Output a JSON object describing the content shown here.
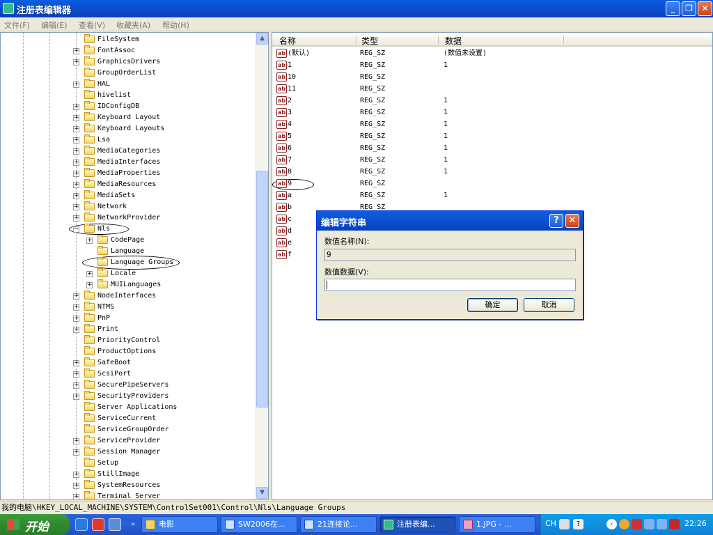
{
  "window": {
    "title": "注册表编辑器"
  },
  "menu": [
    "文件(F)",
    "编辑(E)",
    "查看(V)",
    "收藏夹(A)",
    "帮助(H)"
  ],
  "tree": [
    {
      "label": "FileSystem",
      "expandable": false,
      "level": 1
    },
    {
      "label": "FontAssoc",
      "expandable": true,
      "level": 1
    },
    {
      "label": "GraphicsDrivers",
      "expandable": true,
      "level": 1
    },
    {
      "label": "GroupOrderList",
      "expandable": false,
      "level": 1
    },
    {
      "label": "HAL",
      "expandable": true,
      "level": 1
    },
    {
      "label": "hivelist",
      "expandable": false,
      "level": 1
    },
    {
      "label": "IDConfigDB",
      "expandable": true,
      "level": 1
    },
    {
      "label": "Keyboard Layout",
      "expandable": true,
      "level": 1
    },
    {
      "label": "Keyboard Layouts",
      "expandable": true,
      "level": 1
    },
    {
      "label": "Lsa",
      "expandable": true,
      "level": 1
    },
    {
      "label": "MediaCategories",
      "expandable": true,
      "level": 1
    },
    {
      "label": "MediaInterfaces",
      "expandable": true,
      "level": 1
    },
    {
      "label": "MediaProperties",
      "expandable": true,
      "level": 1
    },
    {
      "label": "MediaResources",
      "expandable": true,
      "level": 1
    },
    {
      "label": "MediaSets",
      "expandable": true,
      "level": 1
    },
    {
      "label": "Network",
      "expandable": true,
      "level": 1
    },
    {
      "label": "NetworkProvider",
      "expandable": true,
      "level": 1
    },
    {
      "label": "Nls",
      "expandable": true,
      "expanded": true,
      "level": 1
    },
    {
      "label": "CodePage",
      "expandable": true,
      "level": 2
    },
    {
      "label": "Language",
      "expandable": false,
      "level": 2
    },
    {
      "label": "Language Groups",
      "expandable": false,
      "level": 2,
      "selected": true
    },
    {
      "label": "Locale",
      "expandable": true,
      "level": 2
    },
    {
      "label": "MUILanguages",
      "expandable": true,
      "level": 2
    },
    {
      "label": "NodeInterfaces",
      "expandable": true,
      "level": 1
    },
    {
      "label": "NTMS",
      "expandable": true,
      "level": 1
    },
    {
      "label": "PnP",
      "expandable": true,
      "level": 1
    },
    {
      "label": "Print",
      "expandable": true,
      "level": 1
    },
    {
      "label": "PriorityControl",
      "expandable": false,
      "level": 1
    },
    {
      "label": "ProductOptions",
      "expandable": false,
      "level": 1
    },
    {
      "label": "SafeBoot",
      "expandable": true,
      "level": 1
    },
    {
      "label": "ScsiPort",
      "expandable": true,
      "level": 1
    },
    {
      "label": "SecurePipeServers",
      "expandable": true,
      "level": 1
    },
    {
      "label": "SecurityProviders",
      "expandable": true,
      "level": 1
    },
    {
      "label": "Server Applications",
      "expandable": false,
      "level": 1
    },
    {
      "label": "ServiceCurrent",
      "expandable": false,
      "level": 1
    },
    {
      "label": "ServiceGroupOrder",
      "expandable": false,
      "level": 1
    },
    {
      "label": "ServiceProvider",
      "expandable": true,
      "level": 1
    },
    {
      "label": "Session Manager",
      "expandable": true,
      "level": 1
    },
    {
      "label": "Setup",
      "expandable": false,
      "level": 1
    },
    {
      "label": "StillImage",
      "expandable": true,
      "level": 1
    },
    {
      "label": "SystemResources",
      "expandable": true,
      "level": 1
    },
    {
      "label": "Terminal Server",
      "expandable": true,
      "level": 1
    }
  ],
  "list": {
    "columns": [
      "名称",
      "类型",
      "数据"
    ],
    "icon_text": "ab",
    "rows": [
      {
        "name": "(默认)",
        "type": "REG_SZ",
        "data": "(数值未设置)"
      },
      {
        "name": "1",
        "type": "REG_SZ",
        "data": "1"
      },
      {
        "name": "10",
        "type": "REG_SZ",
        "data": ""
      },
      {
        "name": "11",
        "type": "REG_SZ",
        "data": ""
      },
      {
        "name": "2",
        "type": "REG_SZ",
        "data": "1"
      },
      {
        "name": "3",
        "type": "REG_SZ",
        "data": "1"
      },
      {
        "name": "4",
        "type": "REG_SZ",
        "data": "1"
      },
      {
        "name": "5",
        "type": "REG_SZ",
        "data": "1"
      },
      {
        "name": "6",
        "type": "REG_SZ",
        "data": "1"
      },
      {
        "name": "7",
        "type": "REG_SZ",
        "data": "1"
      },
      {
        "name": "8",
        "type": "REG_SZ",
        "data": "1"
      },
      {
        "name": "9",
        "type": "REG_SZ",
        "data": ""
      },
      {
        "name": "a",
        "type": "REG_SZ",
        "data": "1"
      },
      {
        "name": "b",
        "type": "REG_SZ",
        "data": ""
      },
      {
        "name": "c",
        "type": "",
        "data": ""
      },
      {
        "name": "d",
        "type": "",
        "data": ""
      },
      {
        "name": "e",
        "type": "",
        "data": ""
      },
      {
        "name": "f",
        "type": "",
        "data": ""
      }
    ]
  },
  "status": {
    "path": "我的电脑\\HKEY_LOCAL_MACHINE\\SYSTEM\\ControlSet001\\Control\\Nls\\Language Groups"
  },
  "dialog": {
    "title": "编辑字符串",
    "help": "?",
    "close": "✕",
    "name_label": "数值名称(N):",
    "name_value": "9",
    "data_label": "数值数据(V):",
    "data_value": "",
    "ok": "确定",
    "cancel": "取消"
  },
  "taskbar": {
    "start": "开始",
    "tasks": [
      {
        "label": "电影",
        "active": false
      },
      {
        "label": "SW2006在...",
        "active": false
      },
      {
        "label": "21连接论...",
        "active": false
      },
      {
        "label": "注册表编...",
        "active": true
      },
      {
        "label": "1.JPG - ...",
        "active": false
      }
    ],
    "lang": "CH",
    "clock": "22:26"
  }
}
